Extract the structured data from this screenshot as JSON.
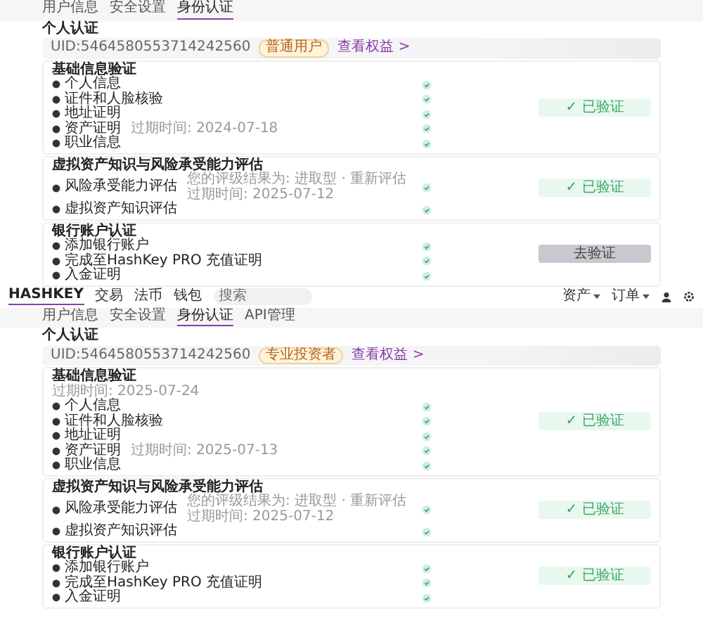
{
  "screens": [
    {
      "tabs": [
        {
          "label": "用户信息",
          "selected": false
        },
        {
          "label": "安全设置",
          "selected": false
        },
        {
          "label": "身份认证",
          "selected": true
        }
      ],
      "title": "个人认证",
      "uid": "UID:5464580553714242560",
      "badge": "普通用户",
      "link": "查看权益 >",
      "sections": [
        {
          "title": "基础信息验证",
          "items": [
            {
              "label": "个人信息",
              "verified": true
            },
            {
              "label": "证件和人脸核验",
              "verified": true
            },
            {
              "label": "地址证明",
              "verified": true
            },
            {
              "label": "资产证明",
              "note": "过期时间: 2024-07-18",
              "verified": true
            },
            {
              "label": "职业信息",
              "verified": true
            }
          ],
          "button": {
            "label": "✓ 已验证",
            "kind": "done"
          }
        },
        {
          "title": "虚拟资产知识与风险承受能力评估",
          "items": [
            {
              "label": "风险承受能力评估",
              "notes": [
                "您的评级结果为: 进取型 · 重新评估",
                "过期时间: 2025-07-12"
              ],
              "verified": true
            },
            {
              "label": "虚拟资产知识评估",
              "verified": true
            }
          ],
          "button": {
            "label": "✓ 已验证",
            "kind": "done"
          }
        },
        {
          "title": "银行账户认证",
          "items": [
            {
              "label": "添加银行账户",
              "verified": true
            },
            {
              "label": "完成至HashKey PRO 充值证明",
              "verified": true
            },
            {
              "label": "入金证明",
              "verified": true
            }
          ],
          "button": {
            "label": "去验证",
            "kind": "disabled"
          }
        }
      ]
    },
    {
      "header": {
        "logo": "HASHKEY",
        "nav": [
          "交易",
          "法币",
          "钱包"
        ],
        "search": {
          "placeholder": "搜索"
        },
        "menus": [
          "资产",
          "订单"
        ]
      },
      "tabs": [
        {
          "label": "用户信息",
          "selected": false
        },
        {
          "label": "安全设置",
          "selected": false
        },
        {
          "label": "身份认证",
          "selected": true
        },
        {
          "label": "API管理",
          "selected": false
        }
      ],
      "title": "个人认证",
      "uid": "UID:5464580553714242560",
      "badge": "专业投资者",
      "link": "查看权益 >",
      "sections": [
        {
          "title": "基础信息验证",
          "subtitle": "过期时间: 2025-07-24",
          "items": [
            {
              "label": "个人信息",
              "verified": true
            },
            {
              "label": "证件和人脸核验",
              "verified": true
            },
            {
              "label": "地址证明",
              "verified": true
            },
            {
              "label": "资产证明",
              "note": "过期时间: 2025-07-13",
              "verified": true
            },
            {
              "label": "职业信息",
              "verified": true
            }
          ],
          "button": {
            "label": "✓ 已验证",
            "kind": "done"
          }
        },
        {
          "title": "虚拟资产知识与风险承受能力评估",
          "items": [
            {
              "label": "风险承受能力评估",
              "notes": [
                "您的评级结果为: 进取型 · 重新评估",
                "过期时间: 2025-07-12"
              ],
              "verified": true
            },
            {
              "label": "虚拟资产知识评估",
              "verified": true
            }
          ],
          "button": {
            "label": "✓ 已验证",
            "kind": "done"
          }
        },
        {
          "title": "银行账户认证",
          "items": [
            {
              "label": "添加银行账户",
              "verified": true
            },
            {
              "label": "完成至HashKey PRO 充值证明",
              "verified": true
            },
            {
              "label": "入金证明",
              "verified": true
            }
          ],
          "button": {
            "label": "✓ 已验证",
            "kind": "done"
          }
        }
      ]
    }
  ]
}
